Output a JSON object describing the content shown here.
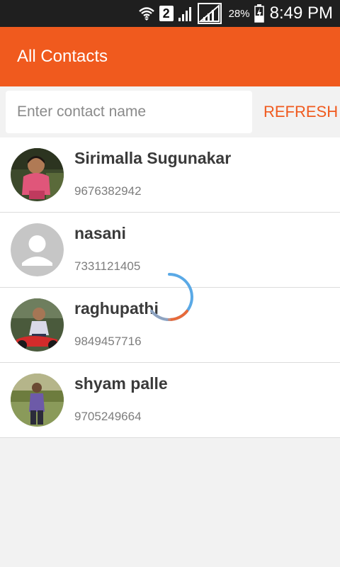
{
  "status_bar": {
    "sim_slot": "2",
    "battery_percent": "28%",
    "time": "8:49 PM"
  },
  "app_bar": {
    "title": "All Contacts"
  },
  "search": {
    "placeholder": "Enter contact name",
    "value": "",
    "refresh_label": "REFRESH"
  },
  "contacts": [
    {
      "name": "Sirimalla Sugunakar",
      "phone": "9676382942",
      "avatar": "photo-child-pink"
    },
    {
      "name": "nasani",
      "phone": "7331121405",
      "avatar": "default-person-icon"
    },
    {
      "name": "raghupathi",
      "phone": "9849457716",
      "avatar": "photo-man-bike"
    },
    {
      "name": "shyam palle",
      "phone": "9705249664",
      "avatar": "photo-man-field"
    }
  ],
  "colors": {
    "accent": "#f05a1e",
    "status_bar": "#1f1f1f",
    "spinner_primary": "#5aa9e6",
    "spinner_secondary": "#e86a3a"
  }
}
